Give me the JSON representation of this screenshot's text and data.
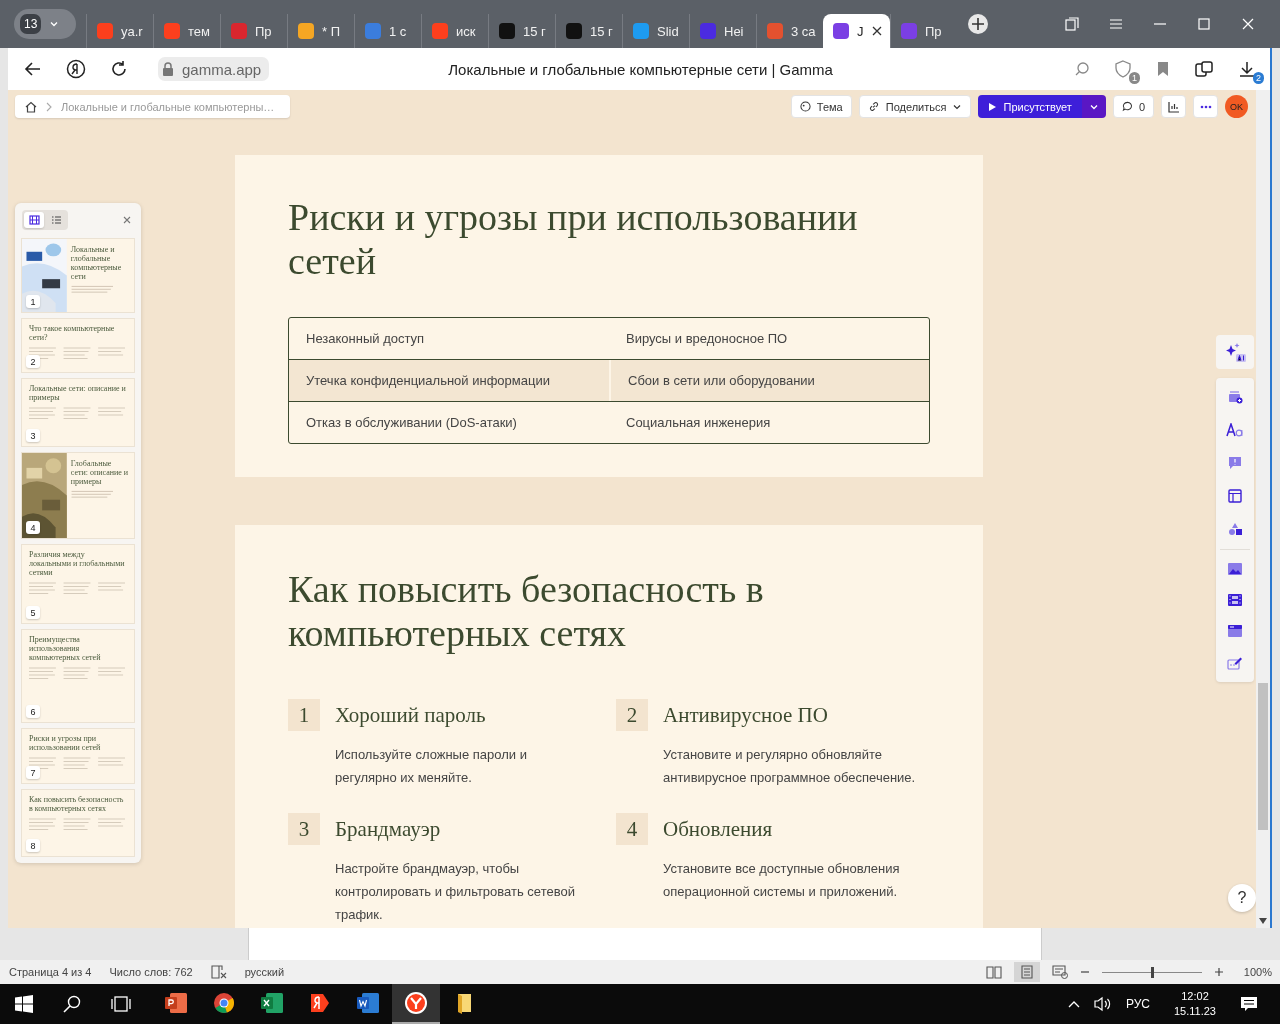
{
  "browser": {
    "tab_count": "13",
    "tabs": [
      {
        "label": "ya.r",
        "color": "#fc3f1d",
        "selected": false
      },
      {
        "label": "тем",
        "color": "#fc3f1d",
        "selected": false
      },
      {
        "label": "Пр",
        "color": "#d9262e",
        "selected": false
      },
      {
        "label": "* П",
        "color": "#f5a623",
        "selected": false
      },
      {
        "label": "1 с",
        "color": "#3b7ddd",
        "selected": false
      },
      {
        "label": "иск",
        "color": "#fc3f1d",
        "selected": false
      },
      {
        "label": "15 г",
        "color": "#111111",
        "selected": false
      },
      {
        "label": "15 г",
        "color": "#111111",
        "selected": false
      },
      {
        "label": "Slid",
        "color": "#1e9bf0",
        "selected": false
      },
      {
        "label": "Неі",
        "color": "#4b2be0",
        "selected": false
      },
      {
        "label": "3 са",
        "color": "#e4512f",
        "selected": false
      },
      {
        "label": "J",
        "color": "#7b3fe4",
        "selected": true
      },
      {
        "label": "Пр",
        "color": "#7b3fe4",
        "selected": false
      }
    ],
    "address": "gamma.app",
    "page_title": "Локальные и глобальные компьютерные сети | Gamma",
    "shield_badge": "1",
    "downloads_badge": "2"
  },
  "toolbar": {
    "breadcrumb": "Локальные и глобальные компьютерны…",
    "theme": "Тема",
    "share": "Поделиться",
    "present": "Присутствует",
    "comments": "0",
    "avatar": "OK"
  },
  "slides_panel": {
    "views": [
      {
        "kind": "grid",
        "selected": true
      },
      {
        "kind": "list",
        "selected": false
      }
    ],
    "slides": [
      {
        "number": "1",
        "title": "Локальные и глобальные компьютерные сети",
        "kind": "picture"
      },
      {
        "number": "2",
        "title": "Что такое компьютерные сети?",
        "kind": "text"
      },
      {
        "number": "3",
        "title": "Локальные сети: описание и примеры",
        "kind": "text"
      },
      {
        "number": "4",
        "title": "Глобальные сети: описание и примеры",
        "kind": "picture"
      },
      {
        "number": "5",
        "title": "Различия между локальными и глобальными сетями",
        "kind": "text"
      },
      {
        "number": "6",
        "title": "Преимущества использования компьютерных сетей",
        "kind": "text"
      },
      {
        "number": "7",
        "title": "Риски и угрозы при использовании сетей",
        "kind": "text"
      },
      {
        "number": "8",
        "title": "Как повысить безопасность в компьютерных сетях",
        "kind": "text"
      }
    ]
  },
  "risks": {
    "title": "Риски и угрозы при использовании сетей",
    "rows": [
      {
        "cells": [
          "Незаконный доступ",
          "Вирусы и вредоносное ПО"
        ],
        "highlighted": false
      },
      {
        "cells": [
          "Утечка конфиденциальной информации",
          "Сбои в сети или оборудовании"
        ],
        "highlighted": true
      },
      {
        "cells": [
          "Отказ в обслуживании (DoS-атаки)",
          "Социальная инженерия"
        ],
        "highlighted": false
      }
    ]
  },
  "security": {
    "title": "Как повысить безопасность в компьютерных сетях",
    "steps": [
      {
        "number": "1",
        "title": "Хороший пароль",
        "text": "Используйте сложные пароли и регулярно их меняйте."
      },
      {
        "number": "2",
        "title": "Антивирусное ПО",
        "text": "Установите и регулярно обновляйте антивирусное программное обеспечение."
      },
      {
        "number": "3",
        "title": "Брандмауэр",
        "text": "Настройте брандмауэр, чтобы контролировать и фильтровать сетевой трафик."
      },
      {
        "number": "4",
        "title": "Обновления",
        "text": "Установите все доступные обновления операционной системы и приложений."
      }
    ]
  },
  "help": "?",
  "word_status": {
    "page": "Страница 4 из 4",
    "words": "Число слов: 762",
    "language": "русский",
    "zoom": "100%",
    "zoom_slider": {
      "level": 0.5
    }
  },
  "taskbar": {
    "apps": [
      {
        "kind": "slides",
        "selected": false
      },
      {
        "kind": "chrome",
        "selected": false
      },
      {
        "kind": "sheets",
        "selected": false
      },
      {
        "kind": "yandex",
        "selected": false
      },
      {
        "kind": "word",
        "selected": false
      },
      {
        "kind": "ybrowser",
        "selected": true
      },
      {
        "kind": "folder",
        "selected": false
      }
    ],
    "language": "РУС",
    "time": "12:02",
    "date": "15.11.23"
  }
}
